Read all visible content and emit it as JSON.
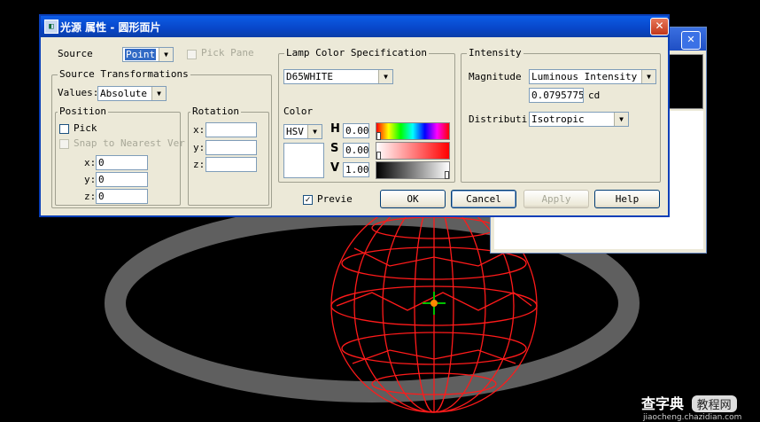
{
  "dialog": {
    "title": "光源 属性 - 圆形面片",
    "close_glyph": "✕"
  },
  "bg_window": {
    "close_glyph": "✕"
  },
  "source": {
    "label": "Source",
    "value": "Point",
    "pick_panel_label": "Pick Pane"
  },
  "transformations": {
    "label": "Source Transformations",
    "values_label": "Values:",
    "values_value": "Absolute"
  },
  "position": {
    "label": "Position",
    "pick_label": "Pick",
    "snap_label": "Snap to Nearest Ver",
    "x_label": "x:",
    "x_value": "0",
    "y_label": "y:",
    "y_value": "0",
    "z_label": "z:",
    "z_value": "0"
  },
  "rotation": {
    "label": "Rotation",
    "x_label": "x:",
    "x_value": "",
    "y_label": "y:",
    "y_value": "",
    "z_label": "z:",
    "z_value": ""
  },
  "lamp_color": {
    "label": "Lamp Color Specification",
    "preset": "D65WHITE"
  },
  "color": {
    "label": "Color",
    "model": "HSV",
    "h_label": "H",
    "h_value": "0.00",
    "s_label": "S",
    "s_value": "0.00",
    "v_label": "V",
    "v_value": "1.00"
  },
  "intensity": {
    "label": "Intensity",
    "magnitude_label": "Magnitude",
    "magnitude_type": "Luminous Intensity",
    "magnitude_value": "0.0795775",
    "unit": "cd",
    "distribution_label": "Distributi",
    "distribution_value": "Isotropic"
  },
  "footer": {
    "preview_label": "Previe",
    "preview_checked": true,
    "ok_label": "OK",
    "cancel_label": "Cancel",
    "apply_label": "Apply",
    "help_label": "Help"
  },
  "watermark": {
    "line1": "查字典",
    "line1b": "教程网",
    "line2": "jiaocheng.chazidian.com"
  }
}
